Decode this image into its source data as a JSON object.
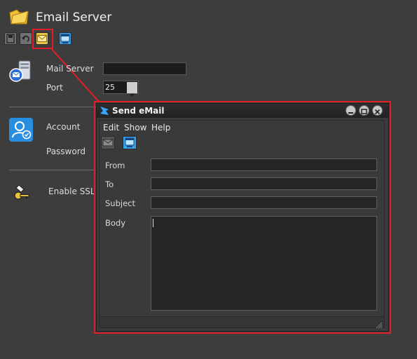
{
  "app": {
    "title": "Email Server",
    "mail_server_label": "Mail Server",
    "mail_server_value": "",
    "port_label": "Port",
    "port_value": "25",
    "account_label": "Account",
    "password_label": "Password",
    "ssl_label": "Enable SSL"
  },
  "toolbar": {
    "icons": [
      "save-icon",
      "undo-icon",
      "email-icon",
      "window-icon"
    ]
  },
  "dialog": {
    "title": "Send eMail",
    "menu": [
      "Edit",
      "Show",
      "Help"
    ],
    "from_label": "From",
    "to_label": "To",
    "subject_label": "Subject",
    "body_label": "Body",
    "from_value": "",
    "to_value": "",
    "subject_value": "",
    "body_value": ""
  },
  "colors": {
    "highlight": "#e01e28",
    "background": "#3d3d3d"
  }
}
